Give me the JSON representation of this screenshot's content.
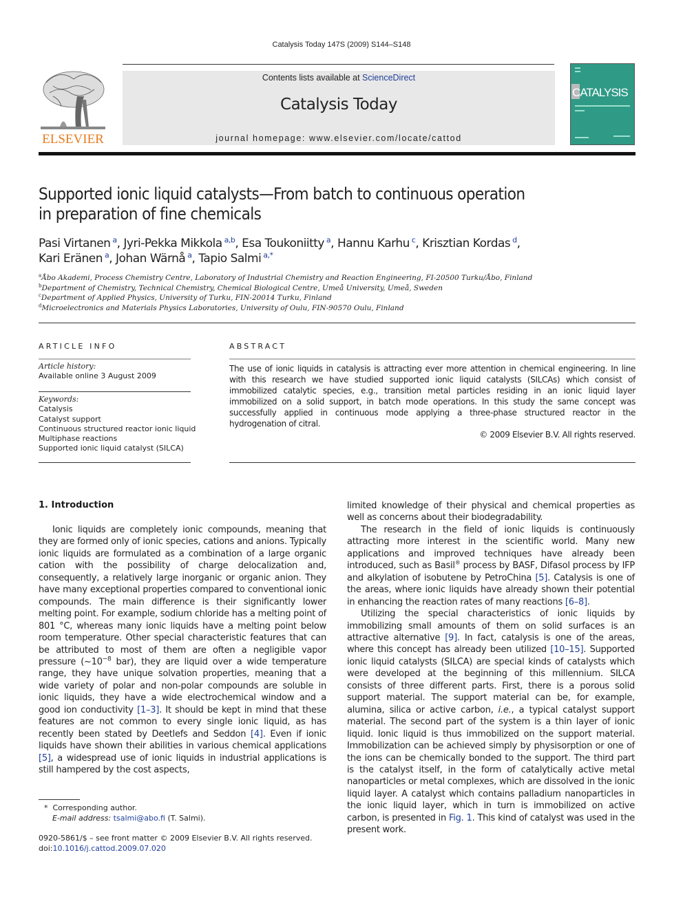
{
  "running_head": "Catalysis Today 147S (2009) S144–S148",
  "publisher": {
    "logo_text": "ELSEVIER",
    "logo_color": "#e87b1e"
  },
  "masthead": {
    "contents_prefix": "Contents lists available at ",
    "contents_link": "ScienceDirect",
    "journal_title": "Catalysis Today",
    "homepage": "journal homepage: www.elsevier.com/locate/cattod"
  },
  "cover": {
    "title": "CATALYSIS",
    "color": "#2f9a86"
  },
  "article": {
    "title_line1": "Supported ionic liquid catalysts—From batch to continuous operation",
    "title_line2": "in preparation of fine chemicals",
    "authors": [
      {
        "name": "Pasi Virtanen",
        "aff": "a"
      },
      {
        "name": "Jyri-Pekka Mikkola",
        "aff": "a,b"
      },
      {
        "name": "Esa Toukoniitty",
        "aff": "a"
      },
      {
        "name": "Hannu Karhu",
        "aff": "c"
      },
      {
        "name": "Krisztian Kordas",
        "aff": "d"
      },
      {
        "name": "Kari Eränen",
        "aff": "a"
      },
      {
        "name": "Johan Wärnå",
        "aff": "a"
      },
      {
        "name": "Tapio Salmi",
        "aff": "a,*"
      }
    ],
    "affiliations": [
      {
        "key": "a",
        "text": "Åbo Akademi, Process Chemistry Centre, Laboratory of Industrial Chemistry and Reaction Engineering, FI-20500 Turku/Åbo, Finland"
      },
      {
        "key": "b",
        "text": "Department of Chemistry, Technical Chemistry, Chemical Biological Centre, Umeå University, Umeå, Sweden"
      },
      {
        "key": "c",
        "text": "Department of Applied Physics, University of Turku, FIN-20014 Turku, Finland"
      },
      {
        "key": "d",
        "text": "Microelectronics and Materials Physics Laboratories, University of Oulu, FIN-90570 Oulu, Finland"
      }
    ]
  },
  "article_info": {
    "label": "ARTICLE INFO",
    "history_label": "Article history:",
    "history_value": "Available online 3 August 2009",
    "keywords_label": "Keywords:",
    "keywords": [
      "Catalysis",
      "Catalyst support",
      "Continuous structured reactor ionic liquid",
      "Multiphase reactions",
      "Supported ionic liquid catalyst (SILCA)"
    ]
  },
  "abstract": {
    "label": "ABSTRACT",
    "text": "The use of ionic liquids in catalysis is attracting ever more attention in chemical engineering. In line with this research we have studied supported ionic liquid catalysts (SILCAs) which consist of immobilized catalytic species, e.g., transition metal particles residing in an ionic liquid layer immobilized on a solid support, in batch mode operations. In this study the same concept was successfully applied in continuous mode applying a three-phase structured reactor in the hydrogenation of citral.",
    "copyright": "© 2009 Elsevier B.V. All rights reserved."
  },
  "body": {
    "section_heading": "1.  Introduction",
    "p1": {
      "a": "Ionic liquids are completely ionic compounds, meaning that they are formed only of ionic species, cations and anions. Typically ionic liquids are formulated as a combination of a large organic cation with the possibility of charge delocalization and, consequently, a relatively large inorganic or organic anion. They have many exceptional properties compared to conventional ionic compounds. The main difference is their significantly lower melting point. For example, sodium chloride has a melting point of 801 °C, whereas many ionic liquids have a melting point below room temperature. Other special characteristic features that can be attributed to most of them are often a negligible vapor pressure (~10",
      "exp": "−8",
      "b": " bar), they are liquid over a wide temperature range, they have unique solvation properties, meaning that a wide variety of polar and non-polar compounds are soluble in ionic liquids, they have a wide electrochemical window and a good ion conductivity ",
      "ref1": "[1–3]",
      "c": ". It should be kept in mind that these features are not common to every single ionic liquid, as has recently been stated by Deetlefs and Seddon ",
      "ref2": "[4]",
      "d": ". Even if ionic liquids have shown their abilities in various chemical applications ",
      "ref3": "[5]",
      "e": ", a widespread use of ionic liquids in industrial applications is still hampered by the cost aspects, limited knowledge of their physical and chemical properties as well as concerns about their biodegradability."
    },
    "p2": {
      "a": "The research in the field of ionic liquids is continuously attracting more interest in the scientific world. Many new applications and improved techniques have already been introduced, such as Basil",
      "reg": "®",
      "b": " process by BASF, Difasol process by IFP and alkylation of isobutene by PetroChina ",
      "ref1": "[5]",
      "c": ". Catalysis is one of the areas, where ionic liquids have already shown their potential in enhancing the reaction rates of many reactions ",
      "ref2": "[6–8]",
      "d": "."
    },
    "p3": {
      "a": "Utilizing the special characteristics of ionic liquids by immobilizing small amounts of them on solid surfaces is an attractive alternative ",
      "ref1": "[9]",
      "b": ". In fact, catalysis is one of the areas, where this concept has already been utilized ",
      "ref2": "[10–15]",
      "c": ". Supported ionic liquid catalysts (SILCA) are special kinds of catalysts which were developed at the beginning of this millennium. SILCA consists of three different parts. First, there is a porous solid support material. The support material can be, for example, alumina, silica or active carbon, ",
      "ie": "i.e.",
      "d": ", a typical catalyst support material. The second part of the system is a thin layer of ionic liquid. Ionic liquid is thus immobilized on the support material. Immobilization can be achieved simply by physisorption or one of the ions can be chemically bonded to the support. The third part is the catalyst itself, in the form of catalytically active metal nanoparticles or metal complexes, which are dissolved in the ionic liquid layer. A catalyst which contains palladium nanoparticles in the ionic liquid layer, which in turn is immobilized on active carbon, is presented in ",
      "fig": "Fig. 1",
      "e": ". This kind of catalyst was used in the present work."
    }
  },
  "footnotes": {
    "star": "*",
    "corresponding": "Corresponding author.",
    "email_label": "E-mail address:",
    "email": "tsalmi@abo.fi",
    "email_suffix": " (T. Salmi)."
  },
  "front_matter": {
    "issn_line": "0920-5861/$ – see front matter © 2009 Elsevier B.V. All rights reserved.",
    "doi_prefix": "doi:",
    "doi": "10.1016/j.cattod.2009.07.020"
  },
  "colors": {
    "link": "#1f3f9a",
    "masthead_bg": "#e8e8e8"
  }
}
